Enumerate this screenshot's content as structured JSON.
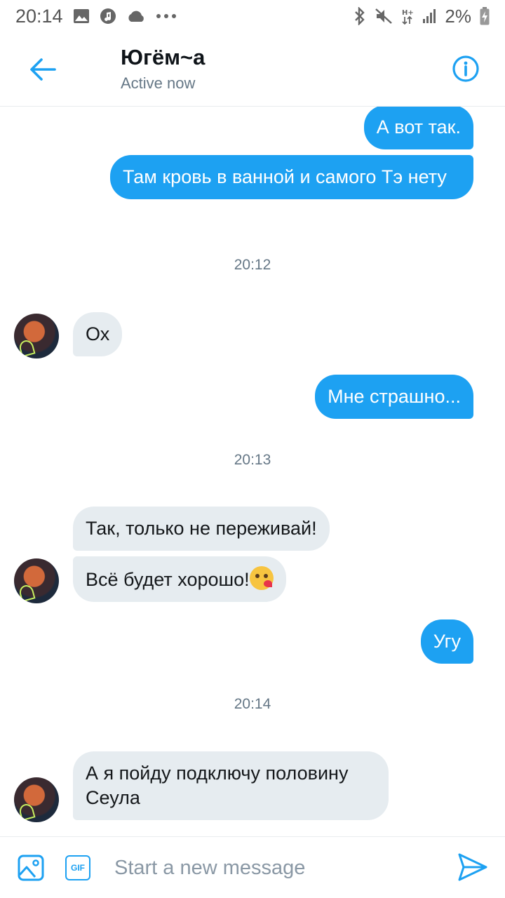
{
  "status_bar": {
    "time": "20:14",
    "battery": "2%"
  },
  "header": {
    "title": "Югём~а",
    "subtitle": "Active now"
  },
  "messages": [
    {
      "dir": "out",
      "text": "А вот так."
    },
    {
      "dir": "out",
      "text": "Там кровь в ванной и самого Тэ нету"
    },
    {
      "dir": "time",
      "text": "20:12"
    },
    {
      "dir": "in",
      "text": "Ох"
    },
    {
      "dir": "out",
      "text": "Мне страшно..."
    },
    {
      "dir": "time",
      "text": "20:13"
    },
    {
      "dir": "in",
      "text": "Так, только не переживай!"
    },
    {
      "dir": "in",
      "text": "Всё будет хорошо!",
      "emoji": "kissing-heart-emoji"
    },
    {
      "dir": "out",
      "text": "Угу"
    },
    {
      "dir": "time",
      "text": "20:14"
    },
    {
      "dir": "in",
      "text": "А я пойду подключу половину Сеула"
    }
  ],
  "composer": {
    "placeholder": "Start a new message",
    "gif_label": "GIF"
  },
  "colors": {
    "accent": "#1da1f2",
    "incoming_bubble": "#e6ecf0",
    "muted_text": "#657786"
  },
  "icons": {
    "back": "arrow-left-icon",
    "info": "info-icon",
    "media": "image-icon",
    "gif": "gif-icon",
    "send": "send-icon"
  }
}
